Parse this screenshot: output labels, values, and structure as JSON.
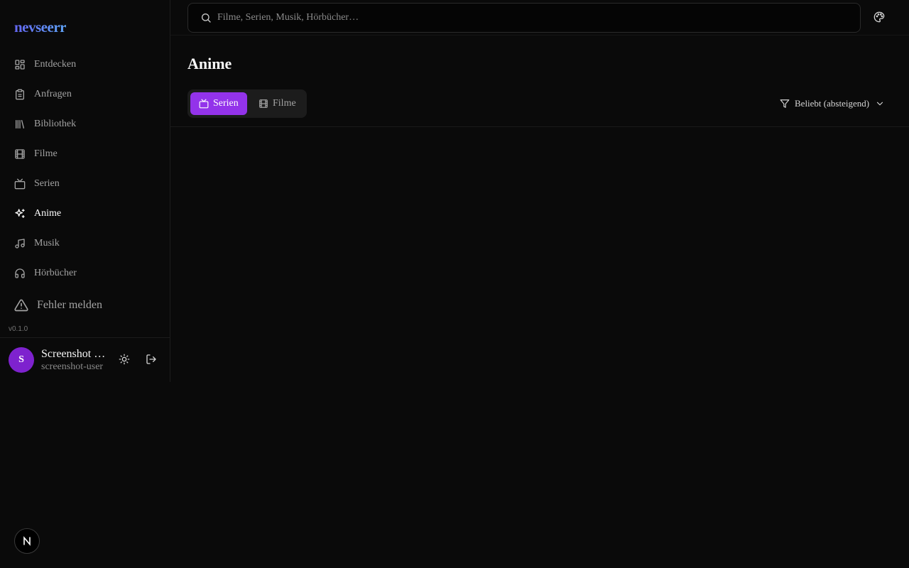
{
  "app": {
    "logo": "nevseerr",
    "version": "v0.1.0"
  },
  "sidebar": {
    "items": [
      {
        "label": "Entdecken",
        "icon": "layout-grid-icon"
      },
      {
        "label": "Anfragen",
        "icon": "clipboard-icon"
      },
      {
        "label": "Bibliothek",
        "icon": "library-icon"
      },
      {
        "label": "Filme",
        "icon": "film-icon"
      },
      {
        "label": "Serien",
        "icon": "tv-icon"
      },
      {
        "label": "Anime",
        "icon": "sparkles-icon",
        "active": true
      },
      {
        "label": "Musik",
        "icon": "music-icon"
      },
      {
        "label": "Hörbücher",
        "icon": "headphones-icon"
      }
    ],
    "report_label": "Fehler melden"
  },
  "user": {
    "initial": "S",
    "name": "Screenshot User",
    "email": "screenshot-user"
  },
  "search": {
    "placeholder": "Filme, Serien, Musik, Hörbücher…"
  },
  "main": {
    "title": "Anime",
    "tabs": [
      {
        "label": "Serien",
        "active": true
      },
      {
        "label": "Filme"
      }
    ],
    "sort_label": "Beliebt (absteigend)"
  },
  "colors": {
    "accent": "#9333ea",
    "avatar": "#7e22ce",
    "background": "#0a0a0a"
  }
}
